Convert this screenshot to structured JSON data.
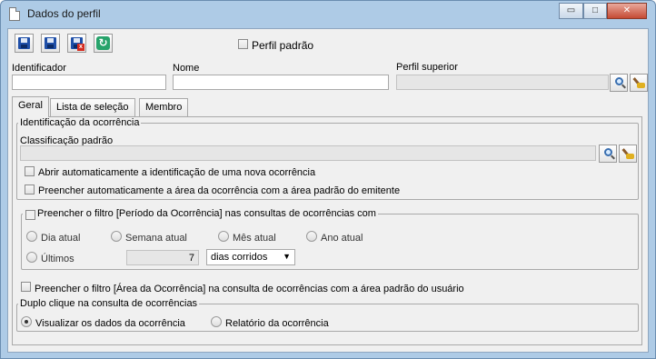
{
  "window": {
    "title": "Dados do perfil",
    "buttons": {
      "minimize": "▭",
      "maximize": "□",
      "close": "✕"
    }
  },
  "toolbar": {
    "icons": [
      "save-icon",
      "save-new-icon",
      "save-close-icon",
      "refresh-icon"
    ],
    "default_profile_label": "Perfil padrão",
    "default_profile_checked": false
  },
  "fields": {
    "identifier": {
      "label": "Identificador",
      "value": ""
    },
    "name": {
      "label": "Nome",
      "value": ""
    },
    "parent_profile": {
      "label": "Perfil superior",
      "value": ""
    }
  },
  "tabs": [
    {
      "label": "Geral",
      "active": true
    },
    {
      "label": "Lista de seleção",
      "active": false
    },
    {
      "label": "Membro",
      "active": false
    }
  ],
  "geral": {
    "identification_group": {
      "legend": "Identificação da ocorrência",
      "classification_label": "Classificação padrão",
      "classification_value": "",
      "auto_open_label": "Abrir automaticamente a identificação de uma nova ocorrência",
      "auto_fill_area_label": "Preencher automaticamente a área da ocorrência com a área padrão do emitente"
    },
    "period_group": {
      "legend": "Preencher o filtro [Período da Ocorrência] nas consultas de ocorrências com",
      "options": [
        "Dia atual",
        "Semana atual",
        "Mês atual",
        "Ano atual"
      ],
      "last_label": "Últimos",
      "last_value": "7",
      "unit": "dias corridos"
    },
    "area_filter_label": "Preencher o filtro [Área da Ocorrência] na consulta de ocorrências com a área padrão do usuário",
    "double_click_group": {
      "legend": "Duplo clique na consulta de ocorrências",
      "options": [
        "Visualizar os dados da ocorrência",
        "Relatório da ocorrência"
      ],
      "selected": "Visualizar os dados da ocorrência"
    }
  },
  "colors": {
    "window_frame": "#aecbe6",
    "client_bg": "#f0f0f0",
    "close_button": "#c54a33"
  }
}
